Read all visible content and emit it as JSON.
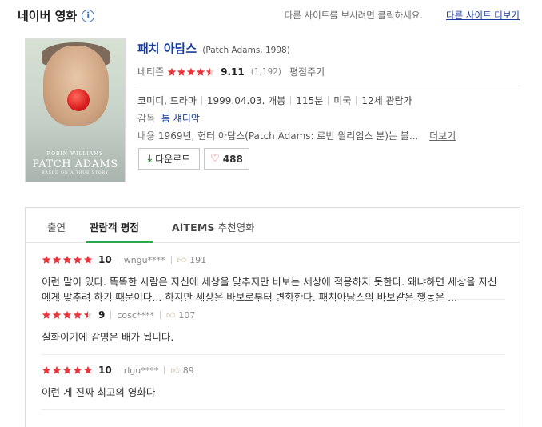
{
  "header": {
    "brand": "네이버 영화",
    "info_icon": "info-icon",
    "message": "다른 사이트를 보시려면 클릭하세요.",
    "link": "다른 사이트 더보기"
  },
  "poster": {
    "actor": "ROBIN WILLIAMS",
    "title": "PATCH ADAMS",
    "tagline": "BASED ON A TRUE STORY"
  },
  "movie": {
    "title_kr": "패치 아담스",
    "title_en": "(Patch Adams, 1998)",
    "rating_label": "네티즌",
    "rating_score": "9.11",
    "rating_stars": 4.5,
    "rating_count": "(1,192)",
    "rate_link": "평점주기",
    "meta": [
      "코미디, 드라마",
      "1999.04.03. 개봉",
      "115분",
      "미국",
      "12세 관람가"
    ],
    "director_label": "감독",
    "director": "톰 섀디악",
    "summary_label": "내용",
    "summary": "1969년, 헌터 아담스(Patch Adams: 로빈 윌리엄스 분)는 불...",
    "more_link": "더보기",
    "download_label": "다운로드",
    "like_count": "488",
    "colors": {
      "link": "#1a3c9c",
      "star": "#e8343b",
      "accent": "#2aa748"
    }
  },
  "tabs": [
    {
      "label": "출연"
    },
    {
      "label": "관람객 평점"
    },
    {
      "label_brand": "AiTEMS",
      "label": "추천영화"
    }
  ],
  "reviews": [
    {
      "stars": 5,
      "score": "10",
      "user": "wngu****",
      "likes": "191",
      "text": "이런 말이 있다. 똑똑한 사람은 자신에 세상을 맞추지만 바보는 세상에 적응하지 못한다. 왜냐하면 세상을 자신에게 맞추려 하기 때문이다... 하지만 세상은 바보로부터 변화한다. 패치아담스의 바보같은 행동은 ..."
    },
    {
      "stars": 4.5,
      "score": "9",
      "user": "cosc****",
      "likes": "107",
      "text": "실화이기에 감명은 배가 됩니다."
    },
    {
      "stars": 5,
      "score": "10",
      "user": "rlgu****",
      "likes": "89",
      "text": "이런 게 진짜 최고의 영화다"
    }
  ]
}
